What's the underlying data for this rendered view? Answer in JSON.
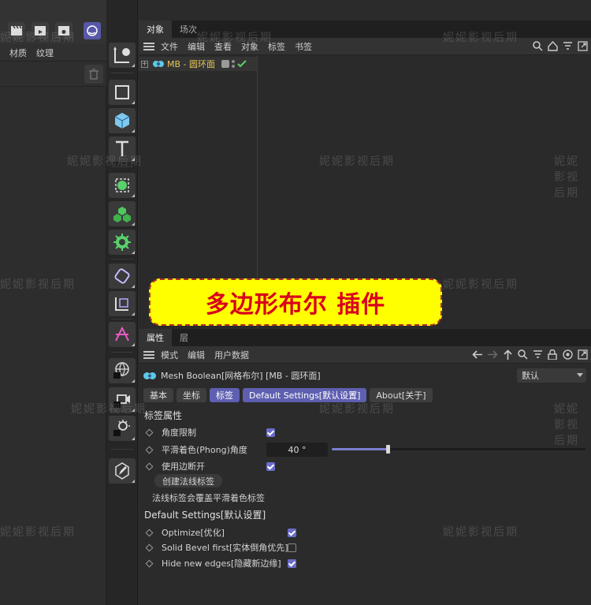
{
  "left_panel": {
    "menu": [
      "材质",
      "纹理"
    ]
  },
  "object_manager": {
    "tabs": [
      "对象",
      "场次"
    ],
    "menu": [
      "文件",
      "编辑",
      "查看",
      "对象",
      "标签",
      "书签"
    ],
    "object_name": "MB - 圆环面"
  },
  "banner": {
    "text": "多边形布尔 插件"
  },
  "attribute_manager": {
    "tabs": [
      "属性",
      "层"
    ],
    "menu": [
      "模式",
      "编辑",
      "用户数据"
    ],
    "title": "Mesh Boolean[网格布尔] [MB - 圆环面]",
    "preset": "默认",
    "subtabs": [
      "基本",
      "坐标",
      "标签",
      "Default Settings[默认设置]",
      "About[关于]"
    ],
    "section1": "标签属性",
    "angle_limit_label": "角度限制",
    "phong_label": "平滑着色(Phong)角度",
    "phong_value": "40 °",
    "phong_fraction": 0.22,
    "use_edge_break_label": "使用边断开",
    "create_normal_tag_button": "创建法线标签",
    "normal_tag_note": "法线标签会覆盖平滑着色标签",
    "section2": "Default Settings[默认设置]",
    "optimize_label": "Optimize[优化]",
    "solid_bevel_label": "Solid Bevel first[实体倒角优先]",
    "hide_edges_label": "Hide new edges[隐藏新边缘]"
  },
  "watermark": "妮妮影视后期",
  "colors": {
    "accent": "#6a6cc8",
    "banner_bg": "#ffff00",
    "banner_text": "#d8001c",
    "object_name": "#e8c85a"
  }
}
